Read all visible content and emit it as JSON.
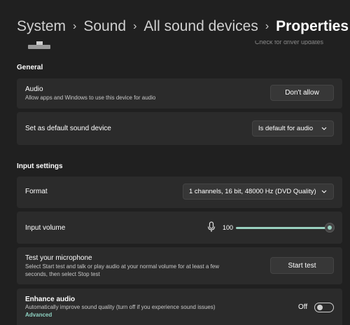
{
  "breadcrumb": {
    "items": [
      "System",
      "Sound",
      "All sound devices"
    ],
    "current": "Properties",
    "separator": "›"
  },
  "top_fragment_text": "Check for driver updates",
  "general": {
    "heading": "General",
    "audio": {
      "title": "Audio",
      "description": "Allow apps and Windows to use this device for audio",
      "button": "Don't allow"
    },
    "default_device": {
      "title": "Set as default sound device",
      "selected": "Is default for audio"
    }
  },
  "input": {
    "heading": "Input settings",
    "format": {
      "title": "Format",
      "selected": "1 channels, 16 bit, 48000 Hz (DVD Quality)"
    },
    "volume": {
      "title": "Input volume",
      "value": "100",
      "level_percent": 100
    },
    "test": {
      "title": "Test your microphone",
      "description_line1": "Select Start test and talk or play audio at your normal volume for at least a few",
      "description_line2": "seconds, then select Stop test",
      "button": "Start test"
    },
    "enhance": {
      "title": "Enhance audio",
      "description": "Automatically improve sound quality (turn off if you experience sound issues)",
      "link": "Advanced",
      "state_label": "Off",
      "on": false
    }
  },
  "colors": {
    "background": "#202020",
    "card": "#2b2b2b",
    "accent": "#9ad1c0"
  }
}
